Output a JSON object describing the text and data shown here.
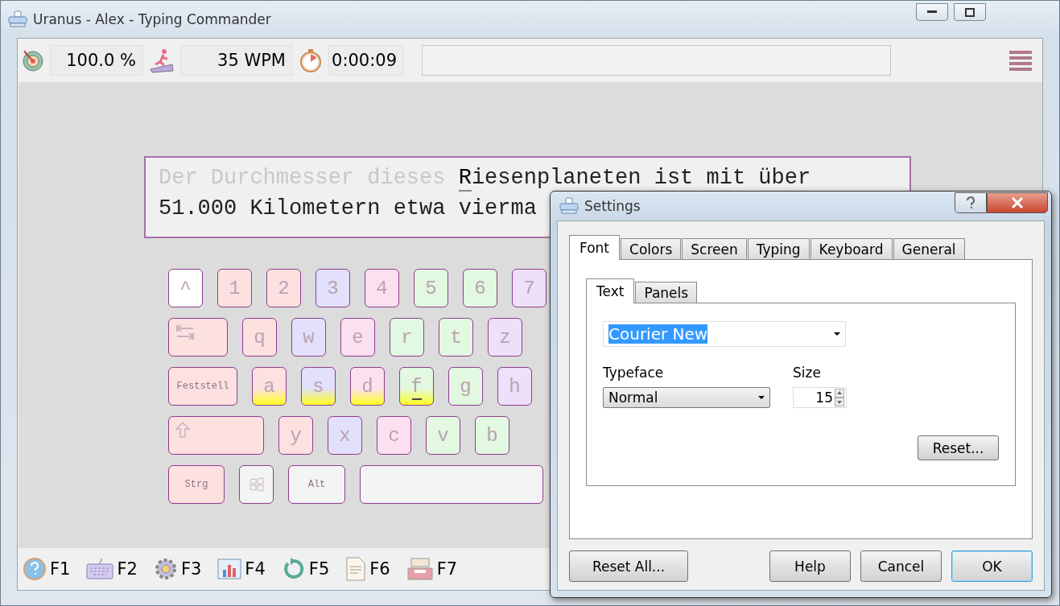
{
  "window": {
    "title": "Uranus - Alex - Typing Commander"
  },
  "stats": [
    {
      "kind": "accuracy",
      "value": "100.0 %"
    },
    {
      "kind": "speed",
      "value": "35 WPM"
    },
    {
      "kind": "time",
      "value": "0:00:09"
    }
  ],
  "lesson": {
    "typed": "Der Durchmesser dieses ",
    "cursor": "R",
    "line_1_rest": "iesenplaneten ist mit über",
    "line_2": "51.000 Kilometern etwa vierma"
  },
  "keyboard": [
    [
      {
        "kind": "char",
        "label": "^",
        "color": "#ffffff",
        "home": false
      },
      {
        "kind": "char",
        "label": "1",
        "color": "#fde0e0",
        "home": false
      },
      {
        "kind": "char",
        "label": "2",
        "color": "#fde0e0",
        "home": false
      },
      {
        "kind": "char",
        "label": "3",
        "color": "#e2e0fb",
        "home": false
      },
      {
        "kind": "char",
        "label": "4",
        "color": "#fde0f0",
        "home": false
      },
      {
        "kind": "char",
        "label": "5",
        "color": "#e2f8e0",
        "home": false
      },
      {
        "kind": "char",
        "label": "6",
        "color": "#e2f8e0",
        "home": false
      },
      {
        "kind": "char",
        "label": "7",
        "color": "#ede0f8",
        "home": false
      }
    ],
    [
      {
        "kind": "tab",
        "color": "#fde0e0",
        "home": false
      },
      {
        "kind": "char",
        "label": "q",
        "color": "#fde0e0",
        "home": false
      },
      {
        "kind": "char",
        "label": "w",
        "color": "#e2e0fb",
        "home": false
      },
      {
        "kind": "char",
        "label": "e",
        "color": "#fde0f0",
        "home": false
      },
      {
        "kind": "char",
        "label": "r",
        "color": "#e2f8e0",
        "home": false
      },
      {
        "kind": "char",
        "label": "t",
        "color": "#e2f8e0",
        "home": false
      },
      {
        "kind": "char",
        "label": "z",
        "color": "#ede0f8",
        "home": false
      }
    ],
    [
      {
        "kind": "caps",
        "label": "Feststell",
        "color": "#fde0e0",
        "home": false
      },
      {
        "kind": "char",
        "label": "a",
        "color": "#fde0e0",
        "home": true
      },
      {
        "kind": "char",
        "label": "s",
        "color": "#e2e0fb",
        "home": true
      },
      {
        "kind": "char",
        "label": "d",
        "color": "#fde0f0",
        "home": true
      },
      {
        "kind": "char",
        "label": "f",
        "color": "#e2f8e0",
        "home": true
      },
      {
        "kind": "char",
        "label": "g",
        "color": "#e2f8e0",
        "home": false
      },
      {
        "kind": "char",
        "label": "h",
        "color": "#ede0f8",
        "home": false
      }
    ],
    [
      {
        "kind": "shift",
        "color": "#fde0e0",
        "home": false
      },
      {
        "kind": "char",
        "label": "y",
        "color": "#fde0e0",
        "home": false
      },
      {
        "kind": "char",
        "label": "x",
        "color": "#e2e0fb",
        "home": false
      },
      {
        "kind": "char",
        "label": "c",
        "color": "#fde0f0",
        "home": false
      },
      {
        "kind": "char",
        "label": "v",
        "color": "#e2f8e0",
        "home": false
      },
      {
        "kind": "char",
        "label": "b",
        "color": "#e2f8e0",
        "home": false
      }
    ],
    [
      {
        "kind": "ctrl",
        "label": "Strg",
        "color": "#fde0e0",
        "home": false
      },
      {
        "kind": "win",
        "color": "#f4f4f4",
        "home": false
      },
      {
        "kind": "alt",
        "label": "Alt",
        "color": "#f4f4f4",
        "home": false
      },
      {
        "kind": "space",
        "color": "#f4f4f4",
        "home": false
      }
    ]
  ],
  "function_keys": [
    {
      "kind": "help",
      "label": "F1"
    },
    {
      "kind": "keyboard",
      "label": "F2"
    },
    {
      "kind": "settings",
      "label": "F3"
    },
    {
      "kind": "chart",
      "label": "F4"
    },
    {
      "kind": "restart",
      "label": "F5"
    },
    {
      "kind": "document",
      "label": "F6"
    },
    {
      "kind": "tray",
      "label": "F7"
    }
  ],
  "settings": {
    "title": "Settings",
    "tabs": [
      {
        "label": "Font",
        "selected": true
      },
      {
        "label": "Colors",
        "selected": false
      },
      {
        "label": "Screen",
        "selected": false
      },
      {
        "label": "Typing",
        "selected": false
      },
      {
        "label": "Keyboard",
        "selected": false
      },
      {
        "label": "General",
        "selected": false
      }
    ],
    "subtabs": [
      {
        "label": "Text",
        "selected": true
      },
      {
        "label": "Panels",
        "selected": false
      }
    ],
    "font": {
      "value": "Courier New",
      "highlighted": true
    },
    "typeface": {
      "label": "Typeface",
      "value": "Normal"
    },
    "size": {
      "label": "Size",
      "value": "15"
    },
    "reset": "Reset...",
    "buttons": [
      {
        "label": "Reset All...",
        "kind": "left",
        "default": false
      },
      {
        "label": "Help",
        "kind": "right",
        "default": false
      },
      {
        "label": "Cancel",
        "kind": "right",
        "default": false
      },
      {
        "label": "OK",
        "kind": "right",
        "default": true
      }
    ]
  }
}
